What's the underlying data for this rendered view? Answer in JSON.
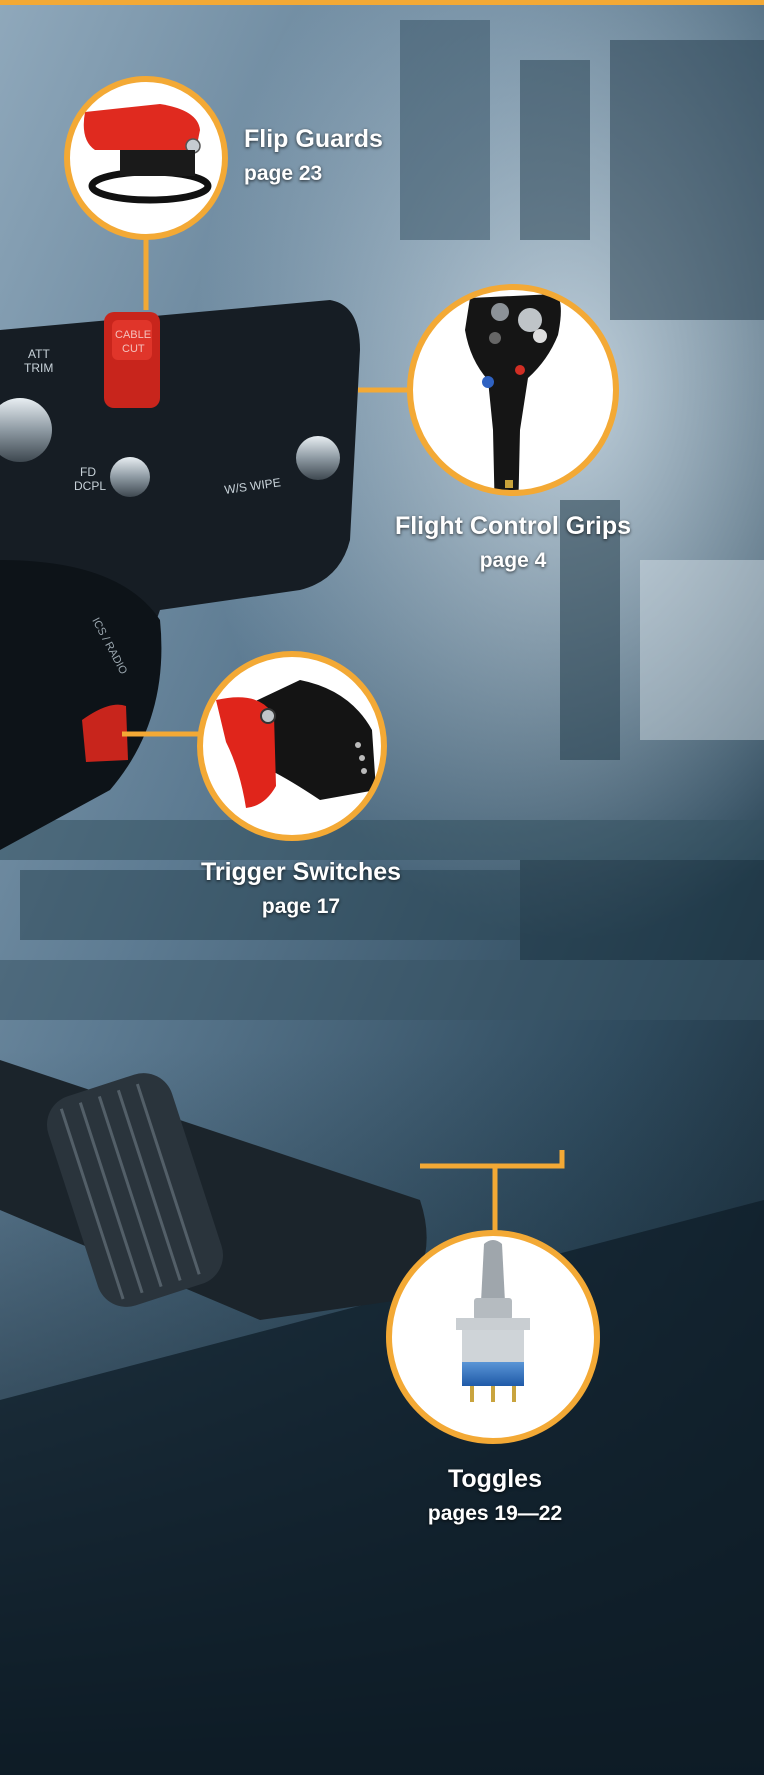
{
  "colors": {
    "accent": "#f3a935",
    "background": "#1b2a35",
    "label_text": "#ffffff"
  },
  "callouts": [
    {
      "title": "Flip Guards",
      "page": "page 23",
      "icon": "flip-guard-icon"
    },
    {
      "title": "Flight Control Grips",
      "page": "page 4",
      "icon": "flight-control-grip-icon"
    },
    {
      "title": "Trigger Switches",
      "page": "page 17",
      "icon": "trigger-switch-icon"
    },
    {
      "title": "Toggles",
      "page": "pages 19—22",
      "icon": "toggle-switch-icon"
    }
  ],
  "panel_markings": {
    "att_trim_line1": "ATT",
    "att_trim_line2": "TRIM",
    "cable_cut_line1": "CABLE",
    "cable_cut_line2": "CUT",
    "fd_line1": "FD",
    "fd_line2": "DCPL",
    "ws_wipe": "W/S WIPE",
    "ics_radio": "ICS / RADIO"
  }
}
